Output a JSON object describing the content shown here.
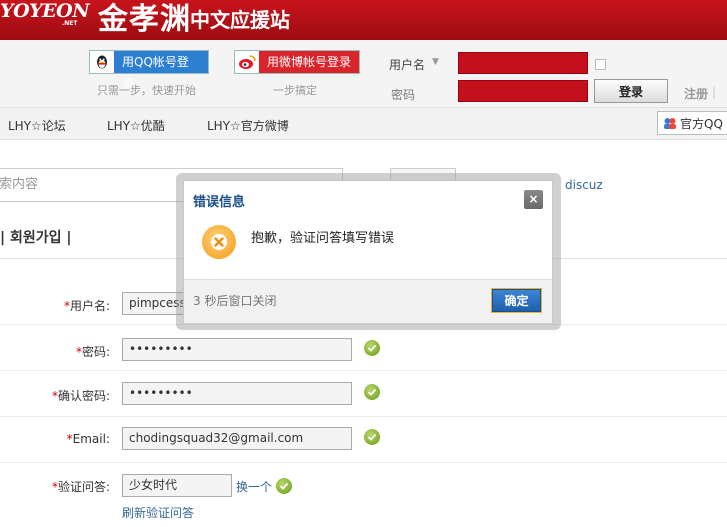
{
  "header": {
    "logo_text": "YOYEON",
    "logo_net": ".NET",
    "site_title": "金孝渊",
    "site_subtitle": "中文应援站"
  },
  "login_bar": {
    "qq_button": "用QQ帐号登录",
    "qq_hint": "只需一步，快速开始",
    "weibo_button": "用微博帐号登录",
    "weibo_hint": "一步搞定",
    "username_label": "用户名",
    "password_label": "密码",
    "login_button": "登录",
    "register_link": "注册"
  },
  "nav": {
    "items": [
      "LHY☆论坛",
      "LHY☆优酷",
      "LHY☆官方微博"
    ],
    "official_qq": "官方QQ"
  },
  "search": {
    "placeholder": "索内容",
    "hot_link": "discuz"
  },
  "form": {
    "title": "| 회원가입 |",
    "fields": [
      {
        "label": "用户名:",
        "value": "pimpcess"
      },
      {
        "label": "密码:",
        "value": "•••••••••"
      },
      {
        "label": "确认密码:",
        "value": "•••••••••"
      },
      {
        "label": "Email:",
        "value": "chodingsquad32@gmail.com"
      },
      {
        "label": "验证问答:",
        "value": "少女时代"
      }
    ],
    "change_link": "换一个",
    "refresh_link": "刷新验证问答"
  },
  "dialog": {
    "title": "错误信息",
    "close_label": "×",
    "message": "抱歉，验证问答填写错误",
    "countdown": "3 秒后窗口关闭",
    "ok_button": "确定"
  },
  "colors": {
    "header_red": "#b3111a",
    "link_blue": "#336699",
    "dialog_title_blue": "#1d4f8c",
    "ok_green": "#7aa82a",
    "error_orange": "#f49a14"
  }
}
